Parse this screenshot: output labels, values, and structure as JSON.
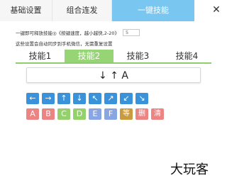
{
  "top_tabs": [
    "基础设置",
    "组合连发",
    "一键技能"
  ],
  "close_glyph": "✕",
  "speed_row": {
    "text": "一键即可释放技能◎《按键速度，越小越快,2-20》",
    "input_value": "5"
  },
  "sync_note": "这些设置会自动同步到手机微信，无需重复设置",
  "skill_tabs": [
    "技能1",
    "技能2",
    "技能3",
    "技能4"
  ],
  "active_skill_tab": "技能2",
  "combo_display": "↓ ↑ A",
  "arrow_keys": [
    "←",
    "→",
    "↑",
    "↓",
    "↖",
    "↗",
    "↙",
    "↘"
  ],
  "letter_keys": [
    "A",
    "B",
    "C",
    "D",
    "E",
    "F",
    "等",
    "删",
    "清"
  ],
  "key_colors": {
    "arrow": "#3a93da",
    "AB": "#ec8484",
    "CD": "#94d16d",
    "EF": "#8aa6e2",
    "wait": "#c99a3e",
    "delete_clear": "#ec8484",
    "active_top_tab": "#79c7f1",
    "active_skill_tab": "#96d475"
  },
  "watermark": "大玩客"
}
